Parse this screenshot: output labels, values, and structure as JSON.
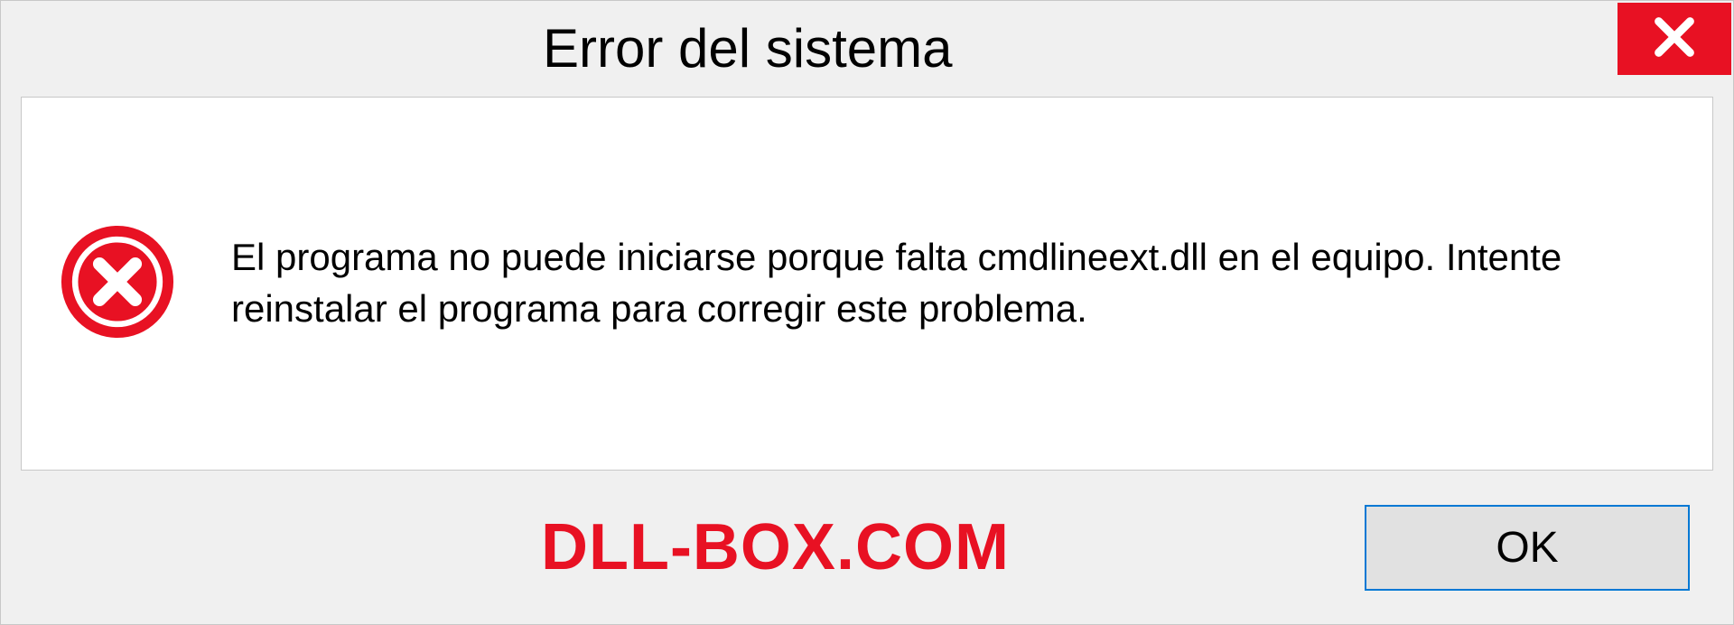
{
  "dialog": {
    "title": "Error del sistema",
    "message": "El programa no puede iniciarse porque falta cmdlineext.dll en el equipo. Intente reinstalar el programa para corregir este problema.",
    "ok_label": "OK"
  },
  "watermark": "DLL-BOX.COM",
  "colors": {
    "error_red": "#e81123",
    "accent_blue": "#0078d4"
  }
}
